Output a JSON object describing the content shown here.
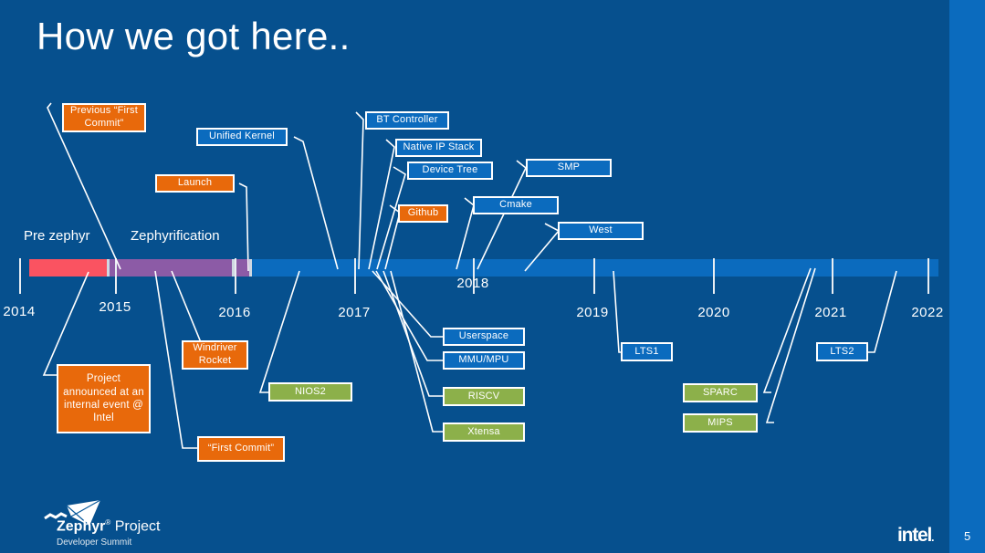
{
  "slide": {
    "title": "How we got here..",
    "page_number": "5",
    "background_color": "#06508E",
    "accent_color": "#0B6BBE"
  },
  "branding": {
    "zephyr_name_bold": "Zephyr",
    "zephyr_registered": "®",
    "zephyr_name_rest": " Project",
    "zephyr_subtitle": "Developer Summit",
    "intel_wordmark": "intel",
    "intel_dot": "."
  },
  "timeline": {
    "years": [
      "2014",
      "2015",
      "2016",
      "2017",
      "2018",
      "2019",
      "2020",
      "2021",
      "2022"
    ],
    "eras": [
      {
        "label": "Pre zephyr",
        "color": "#FA5361"
      },
      {
        "label": "Zephyrification",
        "color": "#8C5BA6"
      }
    ],
    "bar_color": "#0B6BBE"
  },
  "events": [
    {
      "label": "Previous “First Commit”",
      "color": "orange"
    },
    {
      "label": "Unified Kernel",
      "color": "blue"
    },
    {
      "label": "Launch",
      "color": "orange"
    },
    {
      "label": "BT Controller",
      "color": "blue"
    },
    {
      "label": "Native IP Stack",
      "color": "blue"
    },
    {
      "label": "Device Tree",
      "color": "blue"
    },
    {
      "label": "SMP",
      "color": "blue"
    },
    {
      "label": "Github",
      "color": "orange"
    },
    {
      "label": "Cmake",
      "color": "blue"
    },
    {
      "label": "West",
      "color": "blue"
    },
    {
      "label": "Userspace",
      "color": "blue"
    },
    {
      "label": "MMU/MPU",
      "color": "blue"
    },
    {
      "label": "LTS1",
      "color": "blue"
    },
    {
      "label": "LTS2",
      "color": "blue"
    },
    {
      "label": "Project announced at an internal event @ Intel",
      "color": "orange"
    },
    {
      "label": "Windriver Rocket",
      "color": "orange"
    },
    {
      "label": "“First Commit”",
      "color": "orange"
    },
    {
      "label": "NIOS2",
      "color": "green"
    },
    {
      "label": "RISCV",
      "color": "green"
    },
    {
      "label": "Xtensa",
      "color": "green"
    },
    {
      "label": "SPARC",
      "color": "green"
    },
    {
      "label": "MIPS",
      "color": "green"
    }
  ],
  "colors": {
    "orange": "#E8690B",
    "green": "#8CB04A",
    "blue": "#0B6BBE",
    "red": "#FA5361",
    "purple": "#8C5BA6",
    "white": "#FFFFFF"
  }
}
